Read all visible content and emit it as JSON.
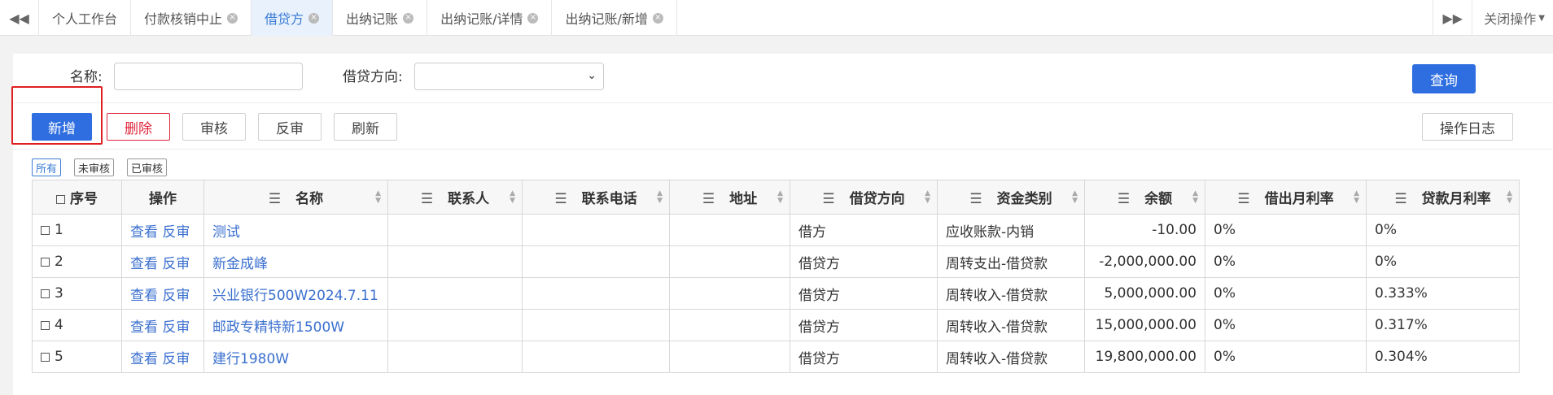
{
  "tabbar": {
    "nav_prev": "◀◀",
    "nav_next": "▶▶",
    "tabs": [
      {
        "label": "个人工作台",
        "closable": false,
        "active": false
      },
      {
        "label": "付款核销中止",
        "closable": true,
        "active": false
      },
      {
        "label": "借贷方",
        "closable": true,
        "active": true
      },
      {
        "label": "出纳记账",
        "closable": true,
        "active": false
      },
      {
        "label": "出纳记账/详情",
        "closable": true,
        "active": false
      },
      {
        "label": "出纳记账/新增",
        "closable": true,
        "active": false
      }
    ],
    "close_ops": "关闭操作"
  },
  "search": {
    "name_label": "名称:",
    "name_value": "",
    "direction_label": "借贷方向:",
    "direction_value": "",
    "query_button": "查询"
  },
  "toolbar": {
    "add": "新增",
    "delete": "删除",
    "audit": "审核",
    "unaudit": "反审",
    "refresh": "刷新",
    "log": "操作日志"
  },
  "filters": [
    "所有",
    "未审核",
    "已审核"
  ],
  "table": {
    "headers": [
      "序号",
      "操作",
      "名称",
      "联系人",
      "联系电话",
      "地址",
      "借贷方向",
      "资金类别",
      "余额",
      "借出月利率",
      "贷款月利率"
    ],
    "view": "查看",
    "unaudit": "反审",
    "rows": [
      {
        "no": "1",
        "name": "测试",
        "contact": "",
        "phone": "",
        "address": "",
        "direction": "借方",
        "category": "应收账款-内销",
        "balance": "-10.00",
        "lend_rate": "0%",
        "loan_rate": "0%"
      },
      {
        "no": "2",
        "name": "新金成峰",
        "contact": "",
        "phone": "",
        "address": "",
        "direction": "借贷方",
        "category": "周转支出-借贷款",
        "balance": "-2,000,000.00",
        "lend_rate": "0%",
        "loan_rate": "0%"
      },
      {
        "no": "3",
        "name": "兴业银行500W2024.7.11",
        "contact": "",
        "phone": "",
        "address": "",
        "direction": "借贷方",
        "category": "周转收入-借贷款",
        "balance": "5,000,000.00",
        "lend_rate": "0%",
        "loan_rate": "0.333%"
      },
      {
        "no": "4",
        "name": "邮政专精特新1500W",
        "contact": "",
        "phone": "",
        "address": "",
        "direction": "借贷方",
        "category": "周转收入-借贷款",
        "balance": "15,000,000.00",
        "lend_rate": "0%",
        "loan_rate": "0.317%"
      },
      {
        "no": "5",
        "name": "建行1980W",
        "contact": "",
        "phone": "",
        "address": "",
        "direction": "借贷方",
        "category": "周转收入-借贷款",
        "balance": "19,800,000.00",
        "lend_rate": "0%",
        "loan_rate": "0.304%"
      }
    ]
  }
}
